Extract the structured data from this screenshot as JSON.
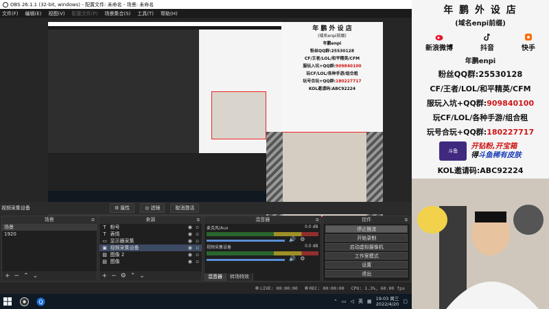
{
  "obs": {
    "title": "OBS 26.1.1 (32-bit, windows) - 配置文件: 未命名 - 场景: 未命名",
    "menu": [
      {
        "label": "文件(F)",
        "dim": false
      },
      {
        "label": "编辑(E)",
        "dim": false
      },
      {
        "label": "视图(V)",
        "dim": false
      },
      {
        "label": "配置文件(P)",
        "dim": true
      },
      {
        "label": "场景集合(S)",
        "dim": false
      },
      {
        "label": "工具(T)",
        "dim": false
      },
      {
        "label": "帮助(H)",
        "dim": false
      }
    ]
  },
  "source_bar": {
    "selected_source": "视频采集设备",
    "properties_label": "属性",
    "filters_label": "滤镜",
    "deactivate_label": "取消激活"
  },
  "scenes": {
    "title": "场景",
    "items": [
      {
        "label": "场景",
        "selected": true
      },
      {
        "label": "1920",
        "selected": false
      }
    ]
  },
  "sources": {
    "title": "来源",
    "items": [
      {
        "label": "粉号",
        "icon": "text-icon",
        "glyph": "T",
        "selected": false
      },
      {
        "label": "表情",
        "icon": "text-icon",
        "glyph": "T",
        "selected": false
      },
      {
        "label": "显示器采集",
        "icon": "monitor-icon",
        "glyph": "▭",
        "selected": false
      },
      {
        "label": "视频采集设备",
        "icon": "camera-icon",
        "glyph": "▣",
        "selected": true
      },
      {
        "label": "图像 2",
        "icon": "image-icon",
        "glyph": "▨",
        "selected": false
      },
      {
        "label": "图像",
        "icon": "image-icon",
        "glyph": "▨",
        "selected": false
      }
    ]
  },
  "mixer": {
    "title": "混音器",
    "channels": [
      {
        "name": "麦克风/Aux",
        "db": "0.0 dB",
        "fill": 0.85
      },
      {
        "name": "视频采集设备",
        "db": "0.0 dB",
        "fill": 0.85
      }
    ],
    "tabs": [
      "混音器",
      "转场特效"
    ]
  },
  "controls": {
    "title": "控件",
    "buttons": [
      {
        "label": "停止推流",
        "active": true
      },
      {
        "label": "开始录制",
        "active": false
      },
      {
        "label": "启动虚拟摄像机",
        "active": false
      },
      {
        "label": "工作室模式",
        "active": false
      },
      {
        "label": "设置",
        "active": false
      },
      {
        "label": "退出",
        "active": false
      }
    ]
  },
  "status": {
    "live": "LIVE: 00:00:00",
    "rec": "REC: 00:00:00",
    "cpu": "CPU: 1.3%, 60.00 fps"
  },
  "taskbar": {
    "language": "英",
    "time": "19:03 周三",
    "date": "2022/4/20"
  },
  "poster": {
    "title": "年 鹏 外 设 店",
    "subtitle": "(域名enpi前缀)",
    "socials": [
      {
        "label": "新浪微博",
        "icon": "weibo-icon",
        "color": "#e6162d"
      },
      {
        "label": "抖音",
        "icon": "douyin-icon",
        "color": "#111111"
      },
      {
        "label": "快手",
        "icon": "kuaishou-icon",
        "color": "#ff6a00"
      }
    ],
    "handle": "年鹏enpi",
    "fan_group_label": "粉丝QQ群:",
    "fan_group_num": "25530128",
    "games_line": "CF/王者/LOL/和平精英/CFM",
    "join_label": "服玩入坑+QQ群:",
    "join_num": "909840100",
    "games_line2": "玩CF/LOL/各种手游/组合租",
    "combo_label": "玩号合玩+QQ群:",
    "combo_num": "180227717",
    "game_logo": "斗鱼",
    "promo_line1_a": "开钻粉,",
    "promo_line1_b": "开宝箱",
    "promo_line2_a": "得",
    "promo_line2_b": "斗鱼稀有皮肤",
    "kol": "KOL邀请码:ABC92224"
  }
}
